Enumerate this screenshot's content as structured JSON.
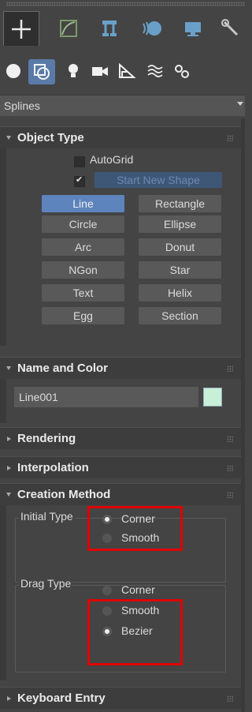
{
  "command_tabs": [
    {
      "icon": "create-plus-icon",
      "active": true
    },
    {
      "icon": "modify-curve-icon",
      "active": false
    },
    {
      "icon": "hierarchy-icon",
      "active": false
    },
    {
      "icon": "motion-icon",
      "active": false
    },
    {
      "icon": "display-monitor-icon",
      "active": false
    },
    {
      "icon": "utilities-wrench-icon",
      "active": false
    }
  ],
  "category_tabs": [
    {
      "icon": "geometry-sphere-icon",
      "active": false
    },
    {
      "icon": "shapes-icon",
      "active": true
    },
    {
      "icon": "lights-bulb-icon",
      "active": false
    },
    {
      "icon": "cameras-icon",
      "active": false
    },
    {
      "icon": "helpers-icon",
      "active": false
    },
    {
      "icon": "space-warps-icon",
      "active": false
    },
    {
      "icon": "systems-icon",
      "active": false
    }
  ],
  "category_dropdown": {
    "value": "Splines"
  },
  "object_type": {
    "title": "Object Type",
    "autogrid_label": "AutoGrid",
    "autogrid_checked": false,
    "start_new_shape_label": "Start New Shape",
    "start_new_shape_checked": true,
    "buttons": [
      "Line",
      "Rectangle",
      "Circle",
      "Ellipse",
      "Arc",
      "Donut",
      "NGon",
      "Star",
      "Text",
      "Helix",
      "Egg",
      "Section"
    ],
    "selected": "Line"
  },
  "name_and_color": {
    "title": "Name and Color",
    "name_value": "Line001",
    "color": "#c8f0d8"
  },
  "rendering": {
    "title": "Rendering"
  },
  "interpolation": {
    "title": "Interpolation"
  },
  "creation_method": {
    "title": "Creation Method",
    "initial_type": {
      "label": "Initial Type",
      "options": [
        "Corner",
        "Smooth"
      ],
      "selected": "Corner"
    },
    "drag_type": {
      "label": "Drag Type",
      "options": [
        "Corner",
        "Smooth",
        "Bezier"
      ],
      "selected": "Bezier"
    }
  },
  "keyboard_entry": {
    "title": "Keyboard Entry"
  },
  "colors": {
    "accent": "#5d84bd",
    "highlight": "#e00000"
  }
}
